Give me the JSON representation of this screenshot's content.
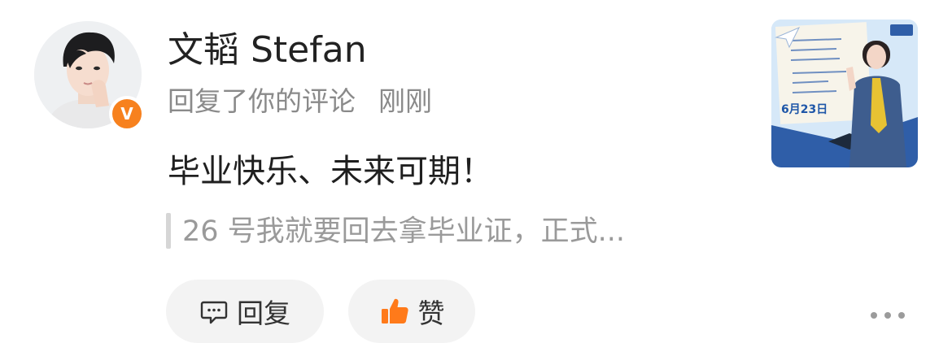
{
  "user": {
    "name": "文韬 Stefan",
    "verified_badge": "V"
  },
  "meta": {
    "action": "回复了你的评论",
    "time": "刚刚"
  },
  "comment": {
    "text": "毕业快乐、未来可期！"
  },
  "quoted": {
    "text": "26 号我就要回去拿毕业证，正式..."
  },
  "actions": {
    "reply_label": "回复",
    "like_label": "赞"
  },
  "thumbnail": {
    "date": "6月23日"
  },
  "colors": {
    "accent": "#f7811e",
    "text": "#222222",
    "muted": "#8a8a8a",
    "pill_bg": "#f3f3f3"
  },
  "icons": {
    "reply": "comment-bubble-icon",
    "like": "thumbs-up-icon",
    "more": "more-dots-icon",
    "verified": "verified-badge-icon"
  }
}
